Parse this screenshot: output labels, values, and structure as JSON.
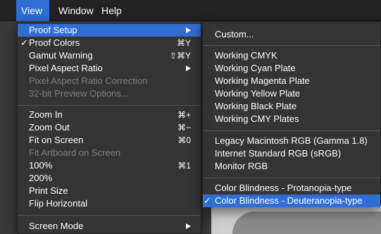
{
  "menubar": {
    "items": [
      {
        "label": "View"
      },
      {
        "label": "Window"
      },
      {
        "label": "Help"
      }
    ]
  },
  "view_menu": {
    "items": [
      {
        "label": "Proof Setup",
        "submenu": true,
        "highlighted": true
      },
      {
        "label": "Proof Colors",
        "checked": true,
        "shortcut": "⌘Y"
      },
      {
        "label": "Gamut Warning",
        "shortcut": "⇧⌘Y"
      },
      {
        "label": "Pixel Aspect Ratio",
        "submenu": true
      },
      {
        "label": "Pixel Aspect Ratio Correction",
        "disabled": true
      },
      {
        "label": "32-bit Preview Options...",
        "disabled": true
      },
      {
        "label": "Zoom In",
        "shortcut": "⌘+"
      },
      {
        "label": "Zoom Out",
        "shortcut": "⌘−"
      },
      {
        "label": "Fit on Screen",
        "shortcut": "⌘0"
      },
      {
        "label": "Fit Artboard on Screen",
        "disabled": true
      },
      {
        "label": "100%",
        "shortcut": "⌘1"
      },
      {
        "label": "200%"
      },
      {
        "label": "Print Size"
      },
      {
        "label": "Flip Horizontal"
      },
      {
        "label": "Screen Mode",
        "submenu": true
      }
    ]
  },
  "proof_setup_submenu": {
    "items": [
      {
        "label": "Custom..."
      },
      {
        "label": "Working CMYK"
      },
      {
        "label": "Working Cyan Plate"
      },
      {
        "label": "Working Magenta Plate"
      },
      {
        "label": "Working Yellow Plate"
      },
      {
        "label": "Working Black Plate"
      },
      {
        "label": "Working CMY Plates"
      },
      {
        "label": "Legacy Macintosh RGB (Gamma 1.8)"
      },
      {
        "label": "Internet Standard RGB (sRGB)"
      },
      {
        "label": "Monitor RGB"
      },
      {
        "label": "Color Blindness - Protanopia-type"
      },
      {
        "label": "Color Blindness - Deuteranopia-type",
        "checked": true,
        "highlighted": true
      }
    ]
  },
  "symbols": {
    "checkmark": "✓"
  },
  "colors": {
    "highlight": "#2f6fd4",
    "menu_background": "#343434",
    "disabled_text": "#7e7e7e"
  }
}
